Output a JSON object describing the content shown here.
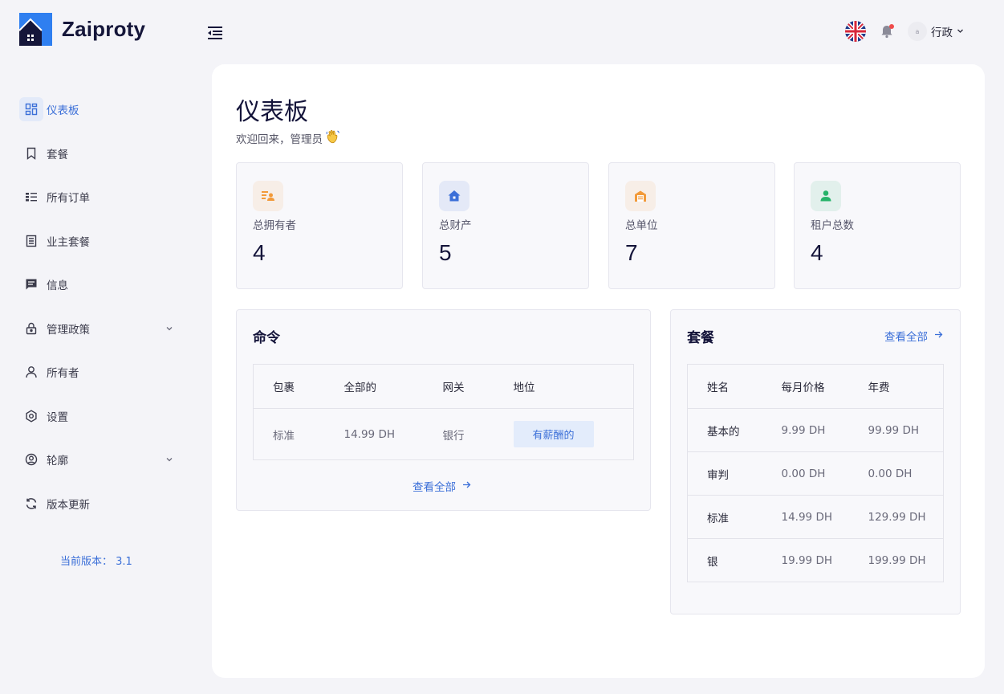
{
  "brand": {
    "name": "Zaiproty"
  },
  "header": {
    "user_label": "行政",
    "avatar_text": "a"
  },
  "sidebar": {
    "items": [
      {
        "label": "仪表板",
        "icon": "dashboard-icon"
      },
      {
        "label": "套餐",
        "icon": "bookmark-icon"
      },
      {
        "label": "所有订单",
        "icon": "list-icon"
      },
      {
        "label": "业主套餐",
        "icon": "document-icon"
      },
      {
        "label": "信息",
        "icon": "message-icon"
      },
      {
        "label": "管理政策",
        "icon": "lock-icon"
      },
      {
        "label": "所有者",
        "icon": "user-icon"
      },
      {
        "label": "设置",
        "icon": "gear-icon"
      },
      {
        "label": "轮廓",
        "icon": "profile-icon"
      },
      {
        "label": "版本更新",
        "icon": "refresh-icon"
      }
    ],
    "version": "当前版本： 3.1"
  },
  "main": {
    "title": "仪表板",
    "welcome": "欢迎回来，管理员",
    "stats": [
      {
        "label": "总拥有者",
        "value": "4",
        "color": "#f29a3a"
      },
      {
        "label": "总财产",
        "value": "5",
        "color": "#3b6fd8"
      },
      {
        "label": "总单位",
        "value": "7",
        "color": "#f29a3a"
      },
      {
        "label": "租户总数",
        "value": "4",
        "color": "#27b36a"
      }
    ],
    "orders": {
      "title": "命令",
      "headers": [
        "包裹",
        "全部的",
        "网关",
        "地位"
      ],
      "rows": [
        {
          "package": "标准",
          "total": "14.99 DH",
          "gateway": "银行",
          "status": "有薪酬的"
        }
      ],
      "view_all": "查看全部"
    },
    "packages": {
      "title": "套餐",
      "view_all": "查看全部",
      "headers": [
        "姓名",
        "每月价格",
        "年费"
      ],
      "rows": [
        {
          "name": "基本的",
          "monthly": "9.99 DH",
          "yearly": "99.99 DH"
        },
        {
          "name": "审判",
          "monthly": "0.00 DH",
          "yearly": "0.00 DH"
        },
        {
          "name": "标准",
          "monthly": "14.99 DH",
          "yearly": "129.99 DH"
        },
        {
          "name": "银",
          "monthly": "19.99 DH",
          "yearly": "199.99 DH"
        }
      ]
    }
  },
  "colors": {
    "accent": "#3b6fd8",
    "brand": "#2f7ff0",
    "sidebar_active_bg": "#e3eaf9"
  }
}
